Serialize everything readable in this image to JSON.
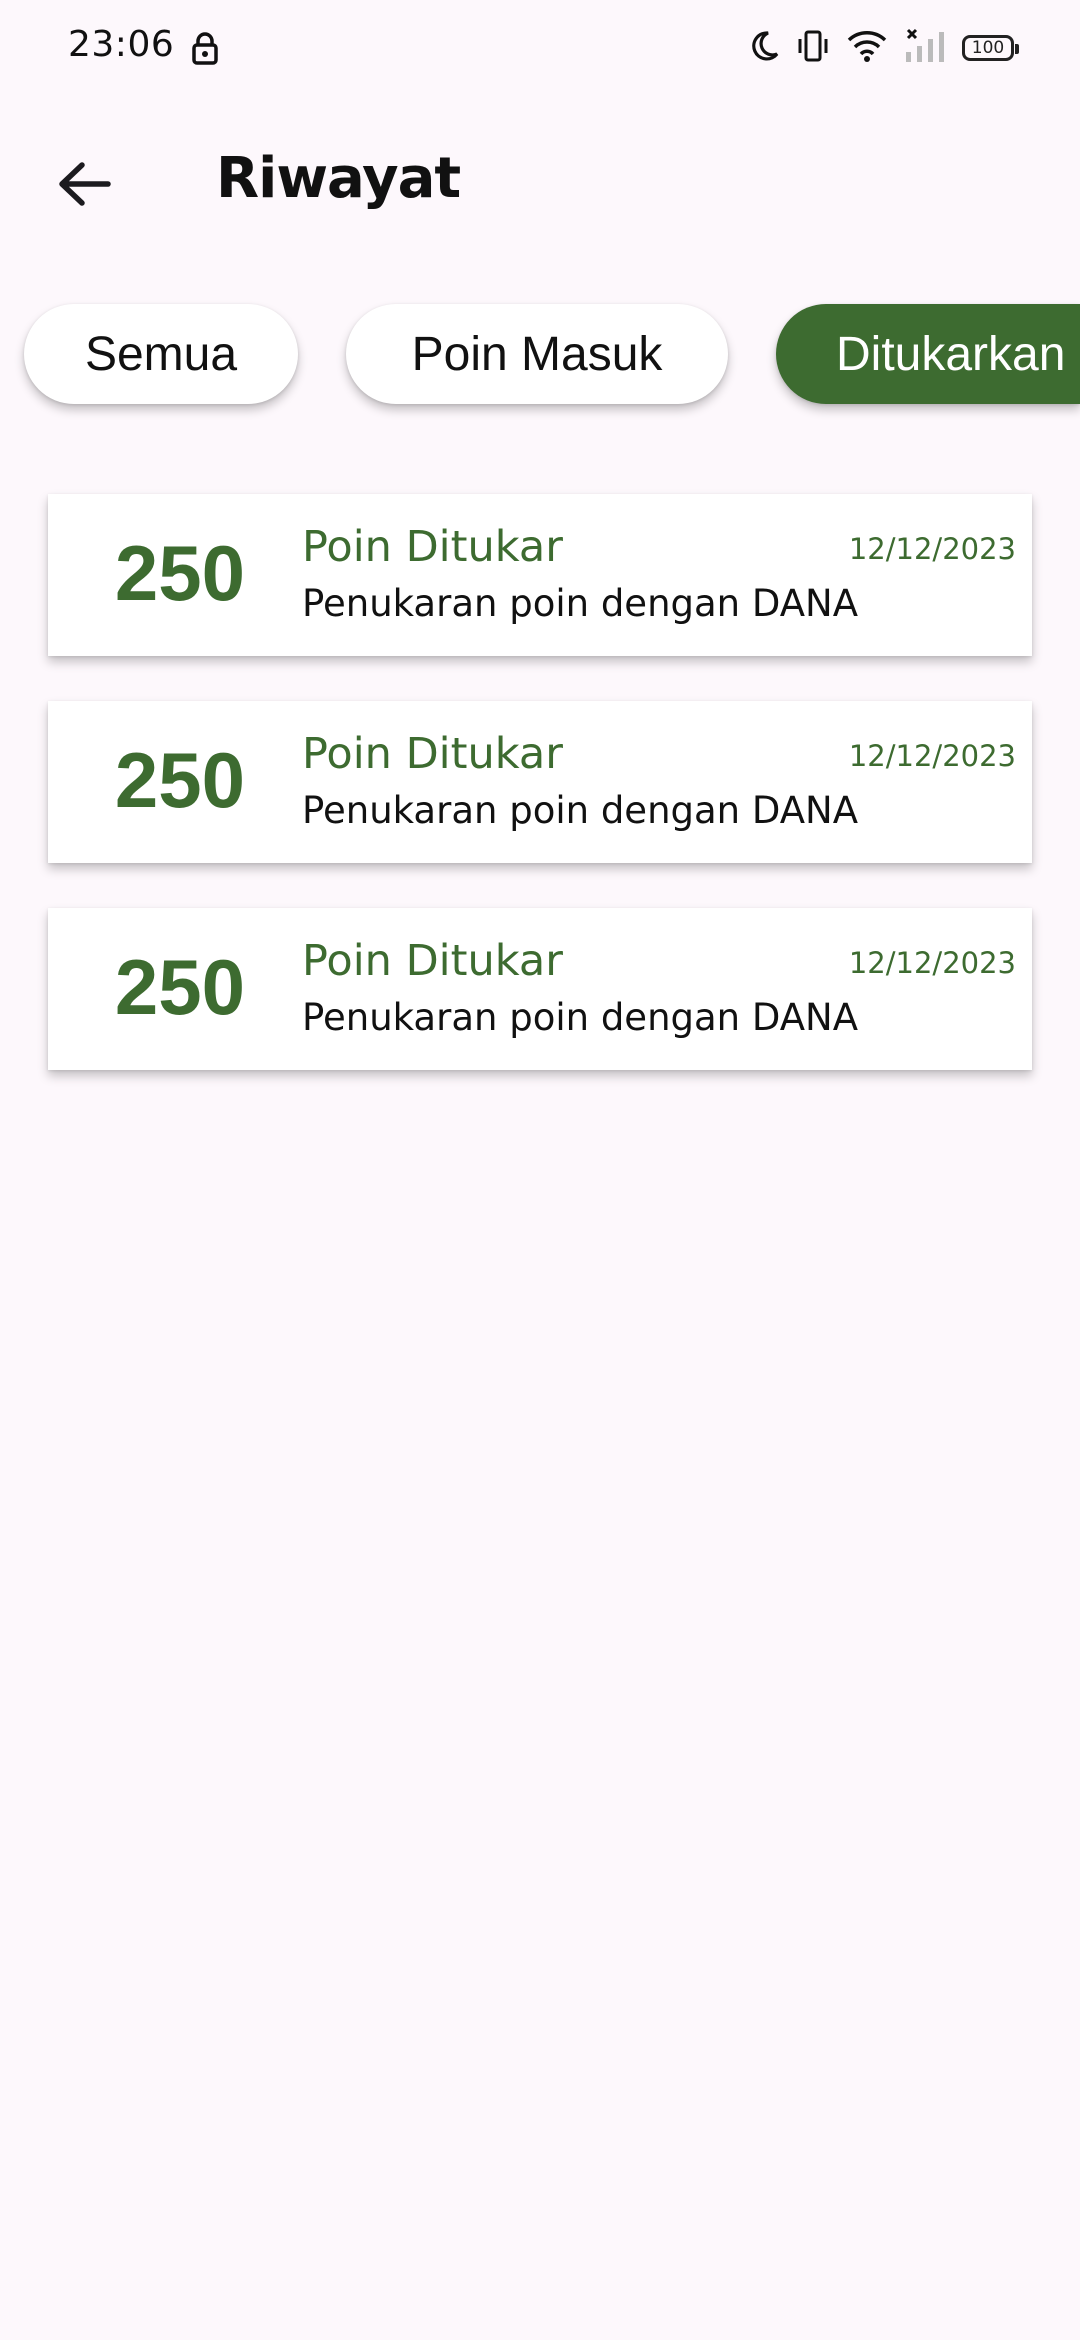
{
  "status_bar": {
    "time": "23:06",
    "battery_level": "100",
    "icons": [
      "lock-icon",
      "moon-icon",
      "vibrate-icon",
      "wifi-icon",
      "signal-off-icon",
      "battery-icon"
    ]
  },
  "app_bar": {
    "title": "Riwayat",
    "back_icon": "arrow-left-icon"
  },
  "filters": [
    {
      "label": "Semua",
      "active": false
    },
    {
      "label": "Poin Masuk",
      "active": false
    },
    {
      "label": "Ditukarkan",
      "active": true
    }
  ],
  "history": [
    {
      "points": "250",
      "title": "Poin Ditukar",
      "date": "12/12/2023",
      "description": "Penukaran poin dengan DANA"
    },
    {
      "points": "250",
      "title": "Poin Ditukar",
      "date": "12/12/2023",
      "description": "Penukaran poin dengan DANA"
    },
    {
      "points": "250",
      "title": "Poin Ditukar",
      "date": "12/12/2023",
      "description": "Penukaran poin dengan DANA"
    }
  ],
  "colors": {
    "accent": "#3d6b30",
    "background": "#fdf8fc",
    "card": "#ffffff"
  }
}
